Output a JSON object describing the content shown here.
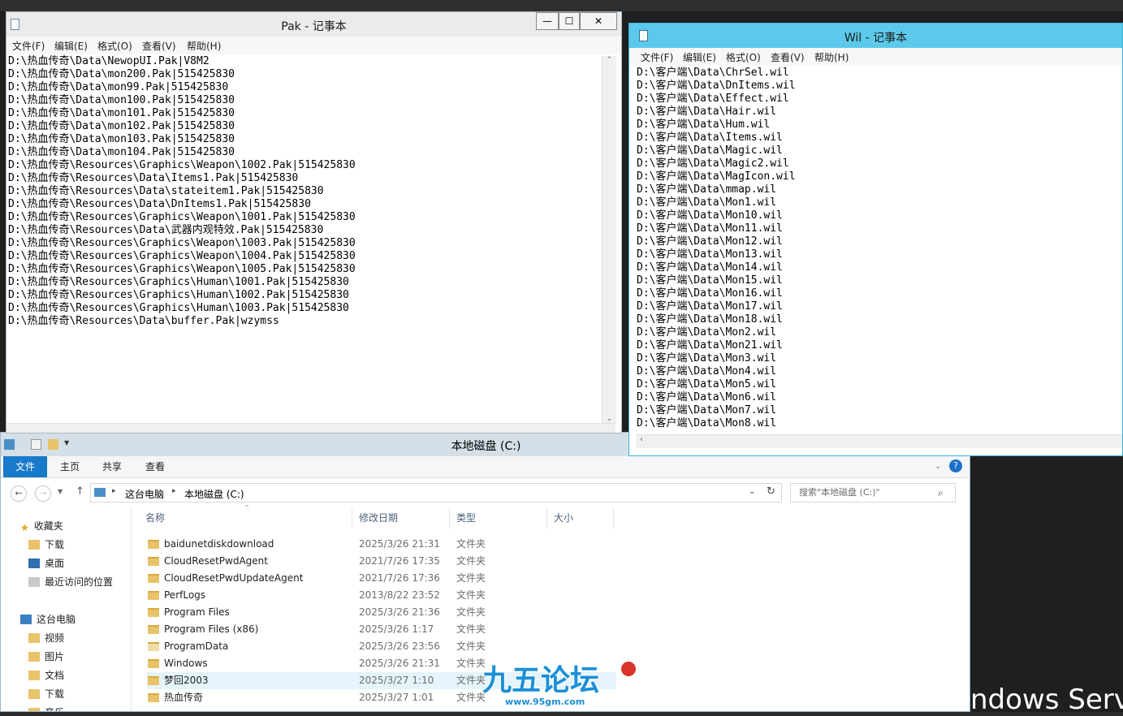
{
  "desktop": {
    "os_text": "ndows Serv"
  },
  "notepad_pak": {
    "title": "Pak - 记事本",
    "menu": [
      "文件(F)",
      "编辑(E)",
      "格式(O)",
      "查看(V)",
      "帮助(H)"
    ],
    "buttons": {
      "minimize": "—",
      "maximize": "☐",
      "close": "✕"
    },
    "lines": [
      "D:\\热血传奇\\Data\\NewopUI.Pak|V8M2",
      "D:\\热血传奇\\Data\\mon200.Pak|515425830",
      "D:\\热血传奇\\Data\\mon99.Pak|515425830",
      "D:\\热血传奇\\Data\\mon100.Pak|515425830",
      "D:\\热血传奇\\Data\\mon101.Pak|515425830",
      "D:\\热血传奇\\Data\\mon102.Pak|515425830",
      "D:\\热血传奇\\Data\\mon103.Pak|515425830",
      "D:\\热血传奇\\Data\\mon104.Pak|515425830",
      "D:\\热血传奇\\Resources\\Graphics\\Weapon\\1002.Pak|515425830",
      "D:\\热血传奇\\Resources\\Data\\Items1.Pak|515425830",
      "D:\\热血传奇\\Resources\\Data\\stateitem1.Pak|515425830",
      "D:\\热血传奇\\Resources\\Data\\DnItems1.Pak|515425830",
      "D:\\热血传奇\\Resources\\Graphics\\Weapon\\1001.Pak|515425830",
      "D:\\热血传奇\\Resources\\Data\\武器内观特效.Pak|515425830",
      "D:\\热血传奇\\Resources\\Graphics\\Weapon\\1003.Pak|515425830",
      "D:\\热血传奇\\Resources\\Graphics\\Weapon\\1004.Pak|515425830",
      "D:\\热血传奇\\Resources\\Graphics\\Weapon\\1005.Pak|515425830",
      "D:\\热血传奇\\Resources\\Graphics\\Human\\1001.Pak|515425830",
      "D:\\热血传奇\\Resources\\Graphics\\Human\\1002.Pak|515425830",
      "D:\\热血传奇\\Resources\\Graphics\\Human\\1003.Pak|515425830",
      "D:\\热血传奇\\Resources\\Data\\buffer.Pak|wzymss"
    ]
  },
  "notepad_wil": {
    "title": "Wil - 记事本",
    "menu": [
      "文件(F)",
      "编辑(E)",
      "格式(O)",
      "查看(V)",
      "帮助(H)"
    ],
    "lines": [
      "D:\\客户端\\Data\\ChrSel.wil",
      "D:\\客户端\\Data\\DnItems.wil",
      "D:\\客户端\\Data\\Effect.wil",
      "D:\\客户端\\Data\\Hair.wil",
      "D:\\客户端\\Data\\Hum.wil",
      "D:\\客户端\\Data\\Items.wil",
      "D:\\客户端\\Data\\Magic.wil",
      "D:\\客户端\\Data\\Magic2.wil",
      "D:\\客户端\\Data\\MagIcon.wil",
      "D:\\客户端\\Data\\mmap.wil",
      "D:\\客户端\\Data\\Mon1.wil",
      "D:\\客户端\\Data\\Mon10.wil",
      "D:\\客户端\\Data\\Mon11.wil",
      "D:\\客户端\\Data\\Mon12.wil",
      "D:\\客户端\\Data\\Mon13.wil",
      "D:\\客户端\\Data\\Mon14.wil",
      "D:\\客户端\\Data\\Mon15.wil",
      "D:\\客户端\\Data\\Mon16.wil",
      "D:\\客户端\\Data\\Mon17.wil",
      "D:\\客户端\\Data\\Mon18.wil",
      "D:\\客户端\\Data\\Mon2.wil",
      "D:\\客户端\\Data\\Mon21.wil",
      "D:\\客户端\\Data\\Mon3.wil",
      "D:\\客户端\\Data\\Mon4.wil",
      "D:\\客户端\\Data\\Mon5.wil",
      "D:\\客户端\\Data\\Mon6.wil",
      "D:\\客户端\\Data\\Mon7.wil",
      "D:\\客户端\\Data\\Mon8.wil"
    ]
  },
  "explorer": {
    "title": "本地磁盘 (C:)",
    "tabs": [
      "文件",
      "主页",
      "共享",
      "查看"
    ],
    "address": {
      "root": "这台电脑",
      "current": "本地磁盘 (C:)"
    },
    "search_placeholder": "搜索\"本地磁盘 (C:)\"",
    "columns": [
      "名称",
      "修改日期",
      "类型",
      "大小"
    ],
    "nav": {
      "favorites_label": "收藏夹",
      "favorites": [
        "下载",
        "桌面",
        "最近访问的位置"
      ],
      "pc_label": "这台电脑",
      "pc_items": [
        "视频",
        "图片",
        "文档",
        "下载",
        "音乐"
      ]
    },
    "files": [
      {
        "name": "baidunetdiskdownload",
        "date": "2025/3/26 21:31",
        "type": "文件夹"
      },
      {
        "name": "CloudResetPwdAgent",
        "date": "2021/7/26 17:35",
        "type": "文件夹"
      },
      {
        "name": "CloudResetPwdUpdateAgent",
        "date": "2021/7/26 17:36",
        "type": "文件夹"
      },
      {
        "name": "PerfLogs",
        "date": "2013/8/22 23:52",
        "type": "文件夹"
      },
      {
        "name": "Program Files",
        "date": "2025/3/26 21:36",
        "type": "文件夹"
      },
      {
        "name": "Program Files (x86)",
        "date": "2025/3/26 1:17",
        "type": "文件夹"
      },
      {
        "name": "ProgramData",
        "date": "2025/3/26 23:56",
        "type": "文件夹"
      },
      {
        "name": "Windows",
        "date": "2025/3/26 21:31",
        "type": "文件夹"
      },
      {
        "name": "梦回2003",
        "date": "2025/3/27 1:10",
        "type": "文件夹"
      },
      {
        "name": "热血传奇",
        "date": "2025/3/27 1:01",
        "type": "文件夹"
      }
    ]
  },
  "watermark": {
    "brand": "九五论坛",
    "url": "www.95gm.com"
  },
  "colors": {
    "explorer_file_tab": "#1979ca",
    "wil_titlebar": "#5cc9ea",
    "folder": "#e8c36a"
  }
}
